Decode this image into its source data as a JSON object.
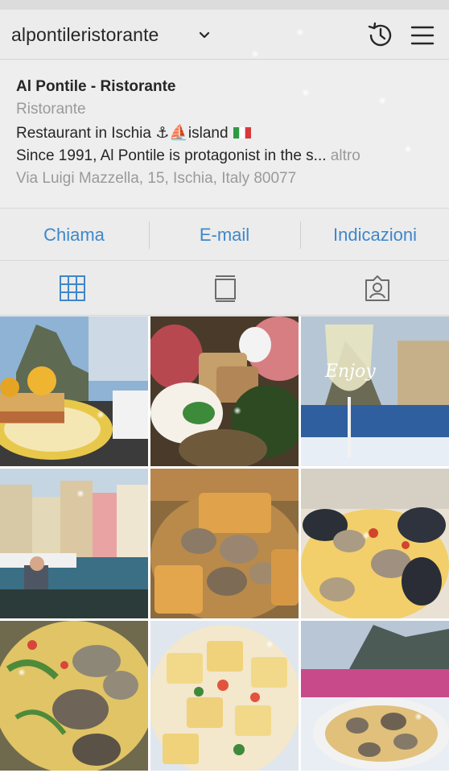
{
  "header": {
    "username": "alpontileristorante"
  },
  "bio": {
    "name": "Al Pontile - Ristorante",
    "category": "Ristorante",
    "description": "Restaurant in Ischia ⚓⛵island",
    "text": "Since 1991, Al Pontile is  protagonist in the s...",
    "more_label": "altro",
    "address": "Via Luigi Mazzella, 15, Ischia, Italy 80077"
  },
  "actions": {
    "call_label": "Chiama",
    "email_label": "E-mail",
    "directions_label": "Indicazioni"
  },
  "tabs": [
    "grid-icon",
    "feed-icon",
    "tagged-icon"
  ],
  "colors": {
    "accent": "#3f87c9",
    "secondary_text": "#9a9a9a"
  },
  "photos": [
    "posts-grid-photo-1",
    "posts-grid-photo-2",
    "posts-grid-photo-3",
    "posts-grid-photo-4",
    "posts-grid-photo-5",
    "posts-grid-photo-6",
    "posts-grid-photo-7",
    "posts-grid-photo-8",
    "posts-grid-photo-9"
  ]
}
